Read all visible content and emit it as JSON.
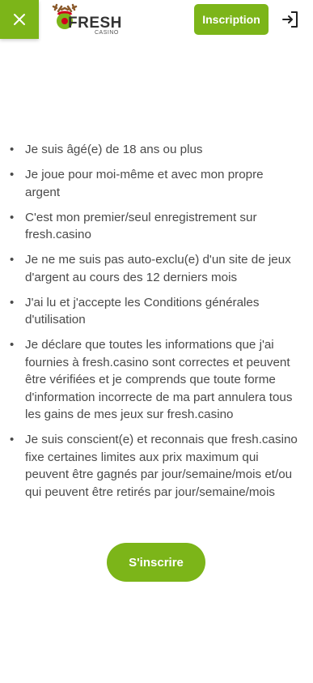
{
  "header": {
    "close_icon": "close-icon",
    "logo_text": "FRESH",
    "logo_subtext": "CASINO",
    "register_label": "Inscription",
    "login_icon": "login-icon"
  },
  "terms": [
    "Je suis âgé(e) de 18 ans ou plus",
    "Je joue pour moi-même et avec mon propre argent",
    "C'est mon premier/seul enregistrement sur fresh.casino",
    "Je ne me suis pas auto-exclu(e) d'un site de jeux d'argent au cours des 12 derniers mois",
    "J'ai lu et j'accepte les Conditions générales d'utilisation",
    "Je déclare que toutes les informations que j'ai fournies à fresh.casino sont correctes et peuvent être vérifiées et je comprends que toute forme d'information incorrecte de ma part annulera tous les gains de mes jeux sur fresh.casino",
    "Je suis conscient(e) et reconnais que fresh.casino fixe certaines limites aux prix maximum qui peuvent être gagnés par jour/semaine/mois et/ou qui peuvent être retirés par jour/semaine/mois"
  ],
  "submit_label": "S'inscrire",
  "colors": {
    "accent": "#7cb519",
    "text": "#4a4a4a"
  }
}
